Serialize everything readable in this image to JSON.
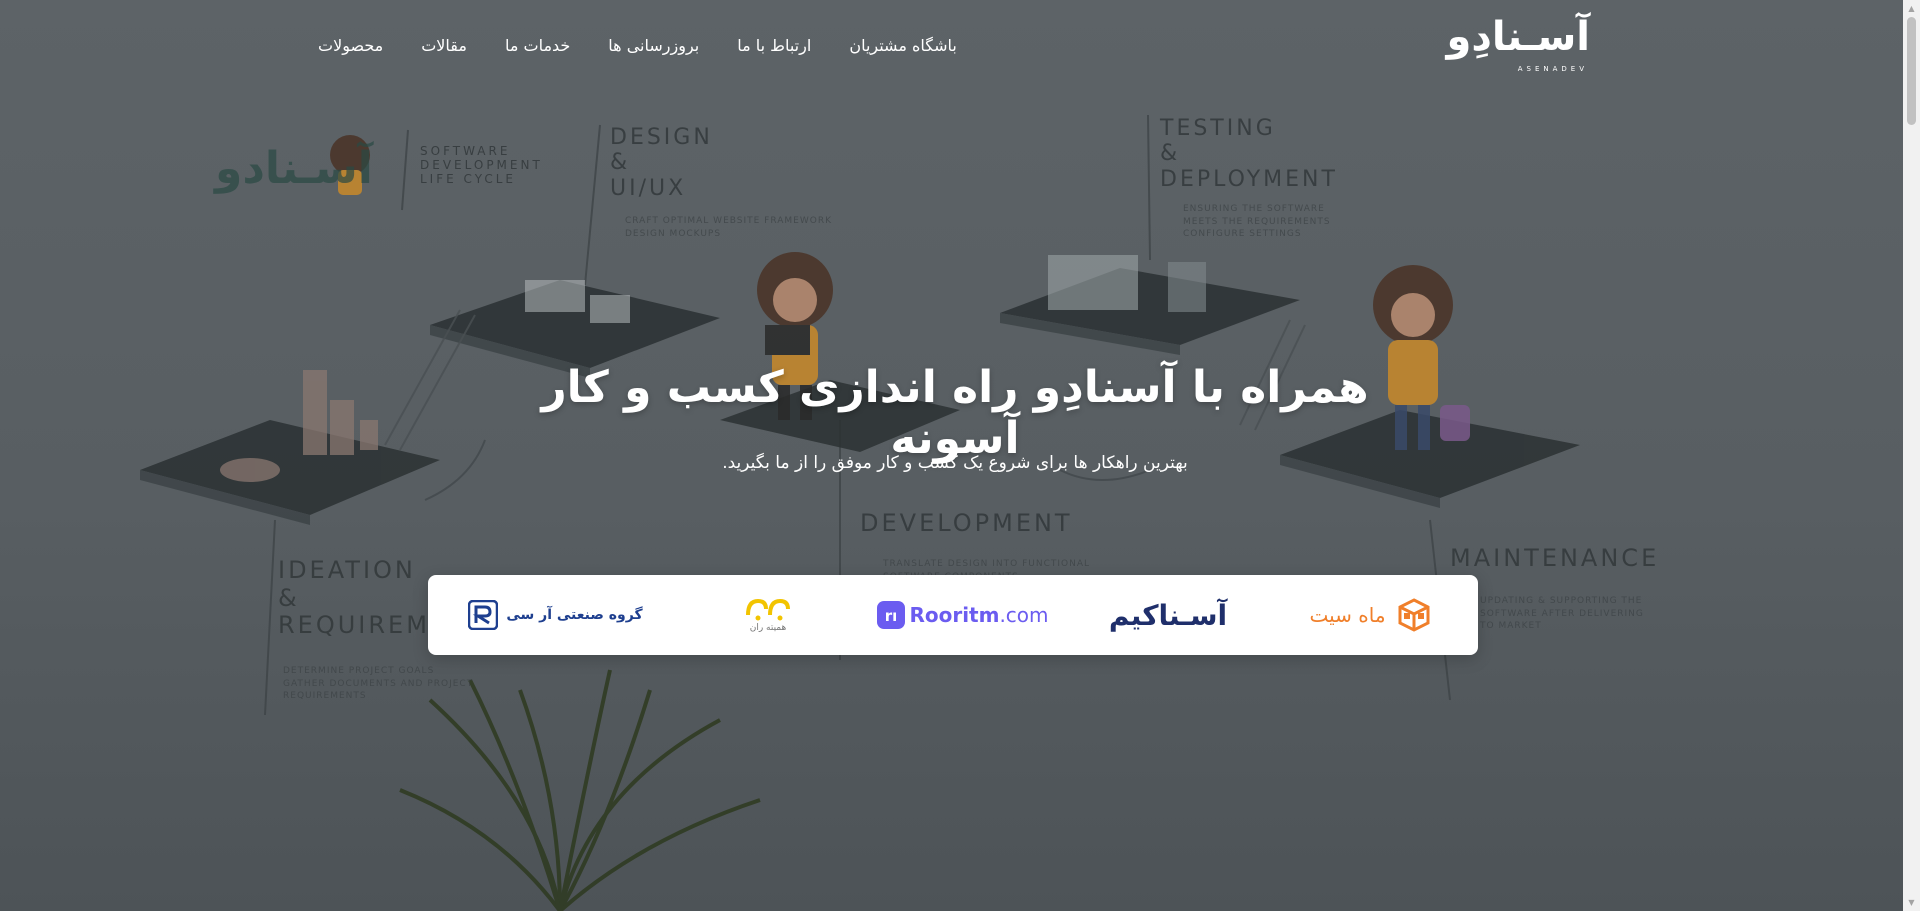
{
  "header": {
    "nav": [
      {
        "label": "محصولات"
      },
      {
        "label": "مقالات"
      },
      {
        "label": "خدمات ما"
      },
      {
        "label": "بروزرسانی ها"
      },
      {
        "label": "ارتباط با ما"
      },
      {
        "label": "باشگاه مشتریان"
      }
    ],
    "brand": {
      "name": "آسـنادِو",
      "latin": "ASENADEV"
    }
  },
  "hero": {
    "title": "همراه با آسنادِو راه اندازی کسب و کار آسونه",
    "subtitle": "بهترین راهکار ها برای شروع یک کسب و کار موفق را از ما بگیرید."
  },
  "background": {
    "logo": "آسـنادو",
    "sdlc_caption": "SOFTWARE\nDEVELOPMENT\nLIFE CYCLE",
    "stages": {
      "design": "DESIGN\n&\nUI/UX",
      "design_note": "CRAFT OPTIMAL WEBSITE FRAMEWORK\nDESIGN MOCKUPS",
      "testing": "TESTING\n&\nDEPLOYMENT",
      "testing_note": "ENSURING THE SOFTWARE\nMEETS THE REQUIREMENTS\nCONFIGURE SETTINGS",
      "development": "DEVELOPMENT",
      "development_note": "TRANSLATE DESIGN INTO FUNCTIONAL\nSOFTWARE COMPONENTS",
      "ideation": "IDEATION\n&\nREQUIREM",
      "ideation_note": "DETERMINE PROJECT GOALS\nGATHER DOCUMENTS AND PROJECT\nREQUIREMENTS",
      "maintenance": "MAINTENANCE",
      "maintenance_note": "UPDATING & SUPPORTING THE\nSOFTWARE AFTER DELIVERING\nTO MARKET"
    }
  },
  "partners": [
    {
      "label": "ماه سیت",
      "color": "#f07f2a"
    },
    {
      "label": "آسـناکیم",
      "color": "#1f2f6b"
    },
    {
      "label": "Rooritm",
      "suffix": ".com",
      "color": "#6b5cf0"
    },
    {
      "label": "همیته ران",
      "color": "#f2c400"
    },
    {
      "label": "گروه صنعتی آر سی",
      "color": "#1e3f8f"
    }
  ],
  "colors": {
    "overlay": "#585e62",
    "partners_bg": "#ffffff",
    "scroll_thumb": "#c1c1c1"
  }
}
